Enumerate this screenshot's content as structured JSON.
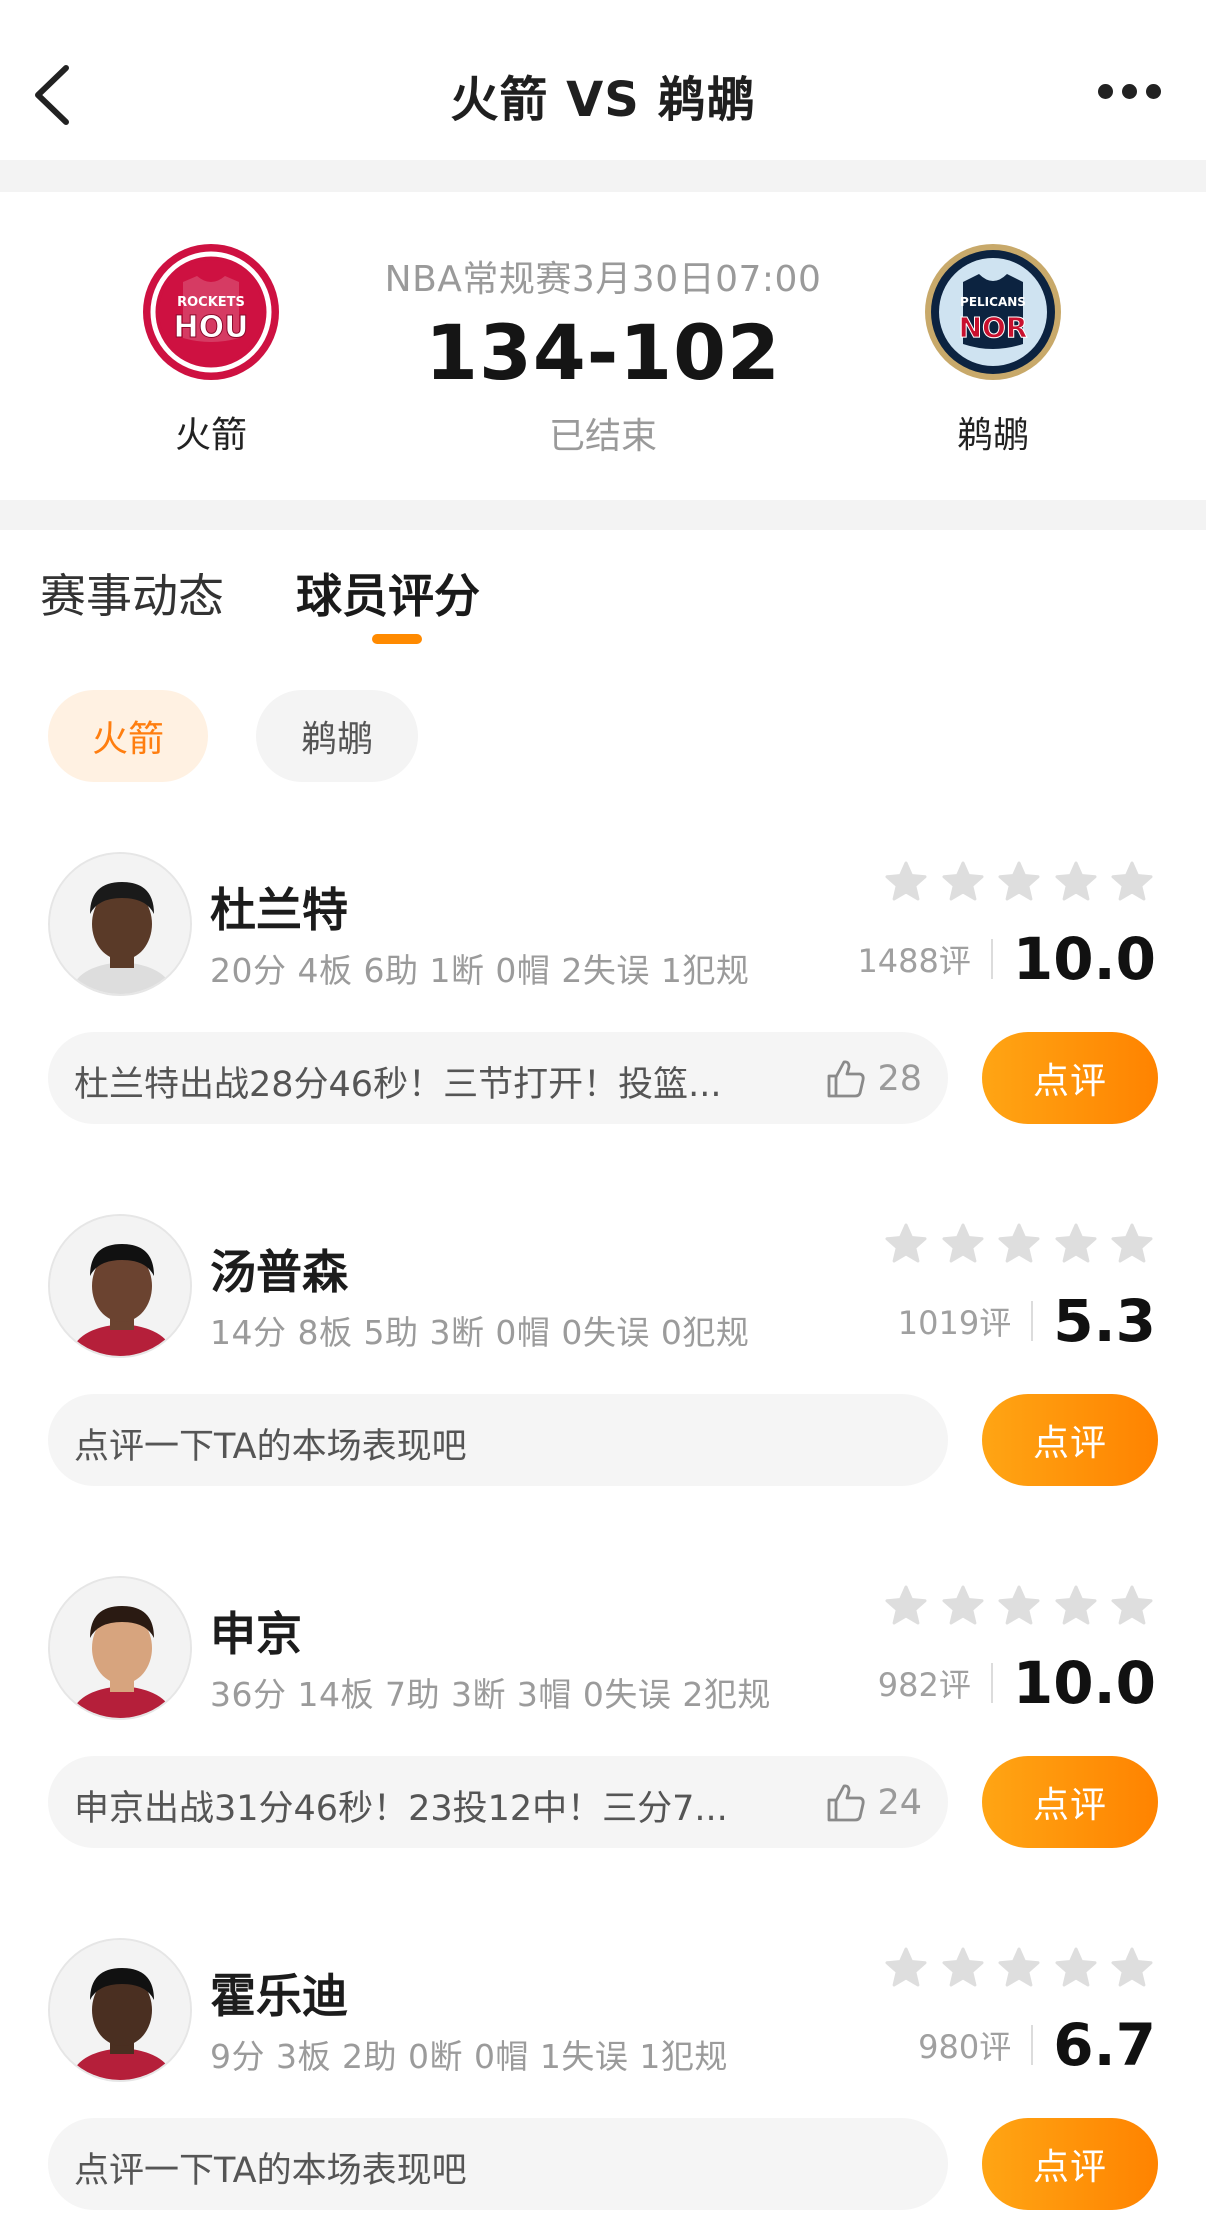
{
  "nav": {
    "title": "火箭 VS 鹈鹕"
  },
  "match": {
    "meta": "NBA常规赛3月30日07:00",
    "score": "134-102",
    "status": "已结束",
    "home": {
      "name": "火箭",
      "logo_top": "ROCKETS",
      "logo_code": "HOU",
      "color": "#ce1141"
    },
    "away": {
      "name": "鹈鹕",
      "logo_top": "PELICANS",
      "logo_code": "NOR",
      "color": "#0c2340"
    }
  },
  "tabs": [
    {
      "label": "赛事动态",
      "active": false
    },
    {
      "label": "球员评分",
      "active": true
    }
  ],
  "team_filter": [
    {
      "label": "火箭",
      "active": true
    },
    {
      "label": "鹈鹕",
      "active": false
    }
  ],
  "players": [
    {
      "name": "杜兰特",
      "stats": "20分 4板 6助 1断 0帽 2失误 1犯规",
      "rating_count": "1488评",
      "score": "10.0",
      "comment": "杜兰特出战28分46秒！三节打开！投篮...",
      "likes": "28",
      "button": "点评"
    },
    {
      "name": "汤普森",
      "stats": "14分 8板 5助 3断 0帽 0失误 0犯规",
      "rating_count": "1019评",
      "score": "5.3",
      "comment": "点评一下TA的本场表现吧",
      "likes": "",
      "button": "点评"
    },
    {
      "name": "申京",
      "stats": "36分 14板 7助 3断 3帽 0失误 2犯规",
      "rating_count": "982评",
      "score": "10.0",
      "comment": "申京出战31分46秒！23投12中！三分7...",
      "likes": "24",
      "button": "点评"
    },
    {
      "name": "霍乐迪",
      "stats": "9分 3板 2助 0断 0帽 1失误 1犯规",
      "rating_count": "980评",
      "score": "6.7",
      "comment": "点评一下TA的本场表现吧",
      "likes": "",
      "button": "点评"
    }
  ],
  "colors": {
    "accent": "#ff8a00",
    "accent_light": "#fff1e2",
    "star": "#dedede"
  },
  "icons": [
    "back-arrow-icon",
    "more-dots-icon",
    "star-icon",
    "thumbs-up-icon"
  ]
}
